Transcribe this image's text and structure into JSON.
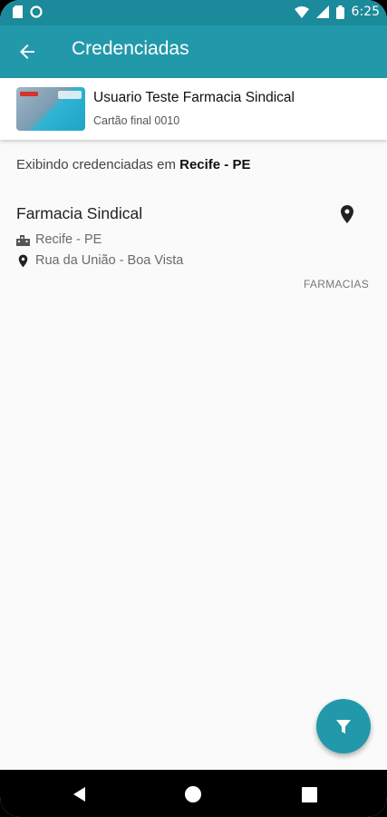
{
  "status_bar": {
    "time": "6:25"
  },
  "app_bar": {
    "title": "Credenciadas"
  },
  "card": {
    "holder_name": "Usuario Teste Farmacia Sindical",
    "card_end": "Cartão final 0010"
  },
  "info": {
    "prefix": "Exibindo credenciadas em ",
    "location": "Recife - PE"
  },
  "pharmacy": {
    "name": "Farmacia Sindical",
    "city": "Recife - PE",
    "address": "Rua da União - Boa Vista",
    "category": "FARMACIAS"
  },
  "colors": {
    "primary": "#2299aa",
    "status_bar": "#1b8a9a",
    "background": "#fafafa"
  },
  "icons": [
    "back-arrow-icon",
    "location-pin-icon",
    "city-icon",
    "filter-icon",
    "nav-back-icon",
    "nav-home-icon",
    "nav-recents-icon"
  ]
}
